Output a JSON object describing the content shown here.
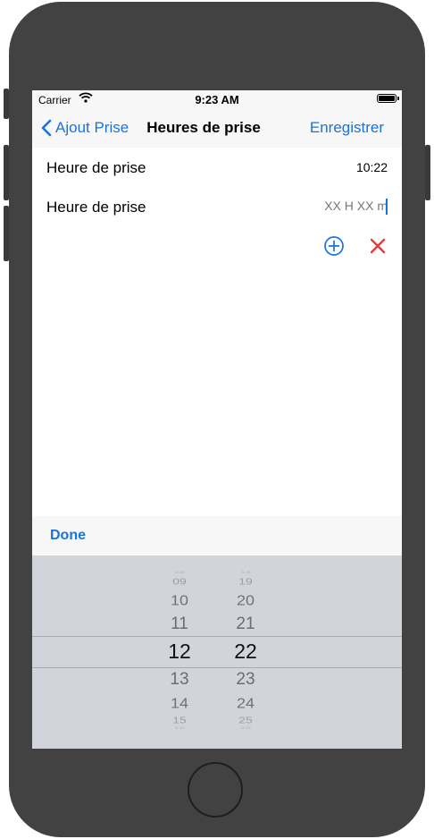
{
  "status_bar": {
    "carrier": "Carrier",
    "time": "9:23 AM"
  },
  "nav": {
    "back_label": "Ajout Prise",
    "title": "Heures de prise",
    "save_label": "Enregistrer"
  },
  "rows": [
    {
      "label": "Heure de prise",
      "value": "10:22"
    },
    {
      "label": "Heure de prise",
      "placeholder": "XX H XX m"
    }
  ],
  "toolbar": {
    "done_label": "Done"
  },
  "picker": {
    "hours": [
      "08",
      "09",
      "10",
      "11",
      "12",
      "13",
      "14",
      "15",
      "16"
    ],
    "minutes": [
      "18",
      "19",
      "20",
      "21",
      "22",
      "23",
      "24",
      "25",
      "26"
    ],
    "selected_hour": "12",
    "selected_minute": "22"
  },
  "colors": {
    "accent": "#1a73d9",
    "delete": "#e53935",
    "picker_bg": "#d1d5db",
    "bezel": "#424242"
  }
}
